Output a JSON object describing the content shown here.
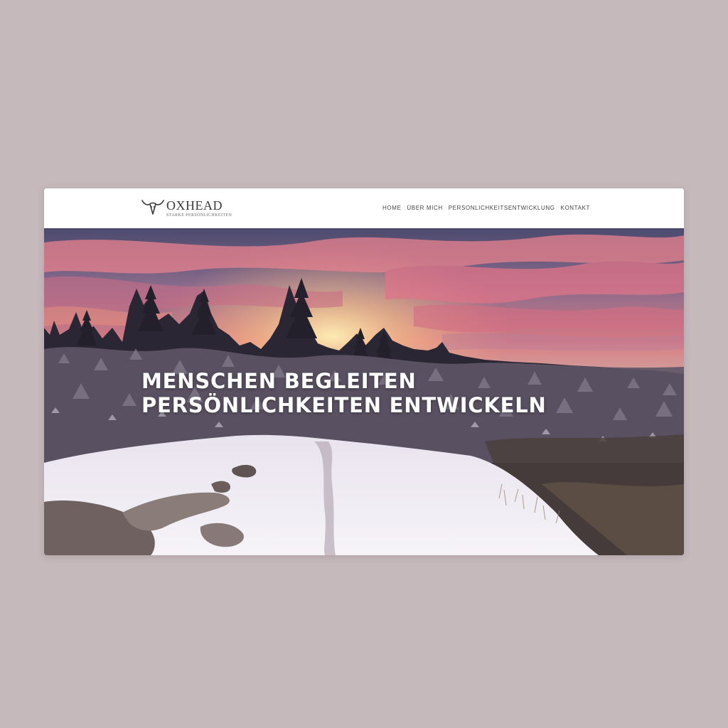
{
  "brand": {
    "name": "OXHEAD",
    "tagline": "STARKE PERSÖNLICHKEITEN",
    "logo_icon": "ox-head-icon"
  },
  "nav": {
    "items": [
      {
        "label": "HOME"
      },
      {
        "label": "ÜBER MICH"
      },
      {
        "label": "PERSONLICHKEITSENTWICKLUNG"
      },
      {
        "label": "KONTAKT"
      }
    ]
  },
  "hero": {
    "headline_line1": "MENSCHEN BEGLEITEN",
    "headline_line2": "PERSÖNLICHKEITEN ENTWICKELN",
    "image": "winter-sunset-forest-photo"
  },
  "colors": {
    "page_background": "#c5b9bc",
    "header_background": "#ffffff",
    "headline_text": "#ffffff",
    "nav_text": "#444444"
  }
}
